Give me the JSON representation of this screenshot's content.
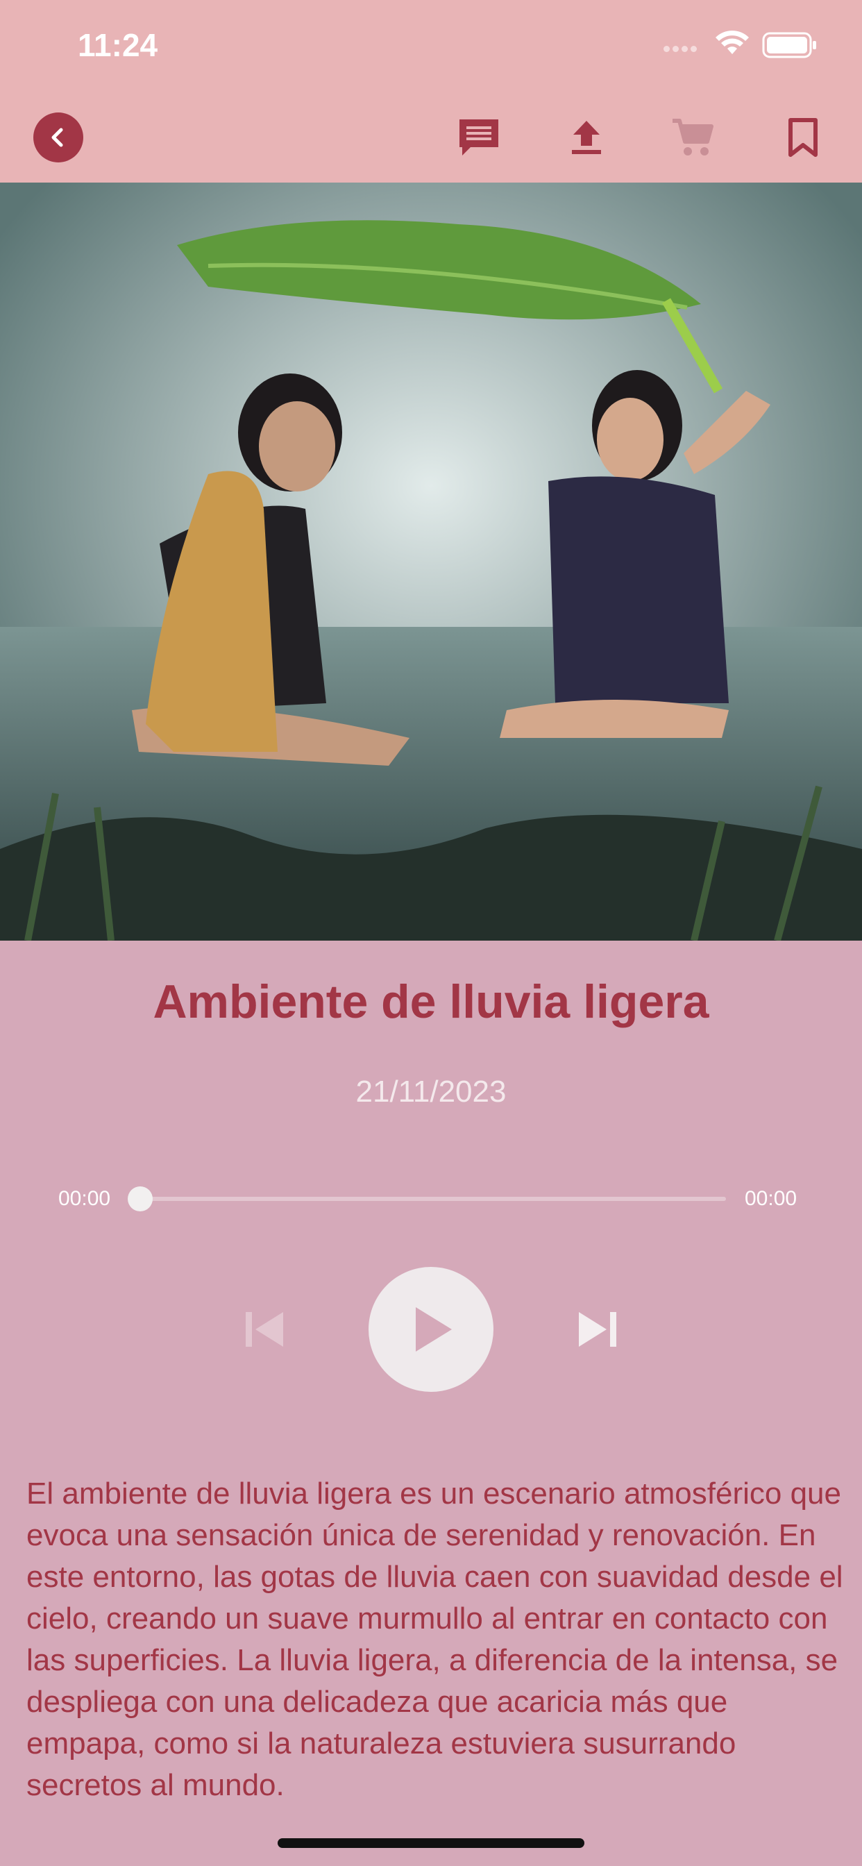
{
  "status_bar": {
    "time": "11:24"
  },
  "nav": {
    "icons": [
      "chevron-left-icon",
      "comment-icon",
      "upload-icon",
      "cart-icon",
      "bookmark-icon"
    ]
  },
  "hero_image": {
    "description_icon": "photo-two-girls-in-rain-under-banana-leaf"
  },
  "track": {
    "title": "Ambiente de lluvia ligera",
    "date": "21/11/2023",
    "elapsed": "00:00",
    "duration": "00:00",
    "progress": 0
  },
  "description": "El ambiente de lluvia ligera es un escenario atmosférico que evoca una sensación única de serenidad y renovación. En este entorno, las gotas de lluvia caen con suavidad desde el cielo, creando un suave murmullo al entrar en contacto con las superficies. La lluvia ligera, a diferencia de la intensa, se despliega con una delicadeza que acaricia más que empapa, como si la naturaleza estuviera susurrando secretos al mundo.",
  "colors": {
    "accent": "#a23646",
    "topbar": "#e8b4b6",
    "background": "#d5a9b9",
    "cart_disabled": "#c98f96"
  }
}
